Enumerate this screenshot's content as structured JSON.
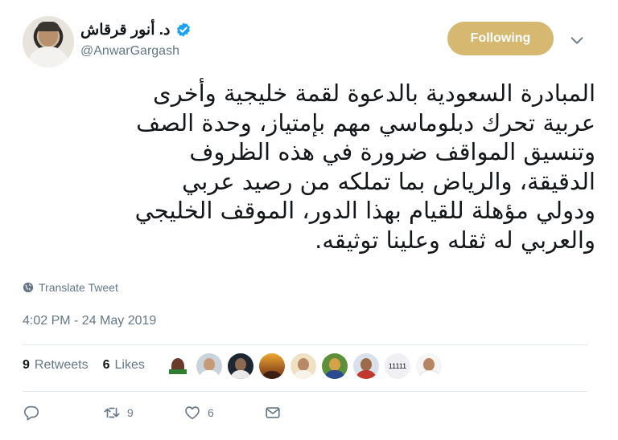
{
  "header": {
    "display_name": "د. أنور قرقاش",
    "handle": "@AnwarGargash",
    "follow_label": "Following"
  },
  "tweet": {
    "lines": [
      "المبادرة السعودية بالدعوة لقمة خليجية وأخرى",
      "عربية تحرك دبلوماسي مهم بإمتياز، وحدة الصف",
      "وتنسيق المواقف ضرورة في هذه الظروف",
      "الدقيقة، والرياض بما تملكه من رصيد عربي",
      "ودولي مؤهلة للقيام بهذا الدور، الموقف الخليجي",
      "والعربي له ثقله وعلينا توثيقه."
    ],
    "translate_label": "Translate Tweet",
    "timestamp": "4:02 PM - 24 May 2019"
  },
  "stats": {
    "retweets_count": "9",
    "retweets_label": "Retweets",
    "likes_count": "6",
    "likes_label": "Likes",
    "liker_badge_text": "11111"
  },
  "actions": {
    "reply_count": "",
    "retweet_count": "9",
    "like_count": "6"
  },
  "colors": {
    "follow_button": "#d6b871",
    "verified": "#1da1f2",
    "muted_text": "#657786",
    "divider": "#e1e8ed"
  },
  "icons": [
    "verified-badge-icon",
    "chevron-down-icon",
    "globe-icon",
    "reply-icon",
    "retweet-icon",
    "heart-icon",
    "envelope-icon"
  ]
}
